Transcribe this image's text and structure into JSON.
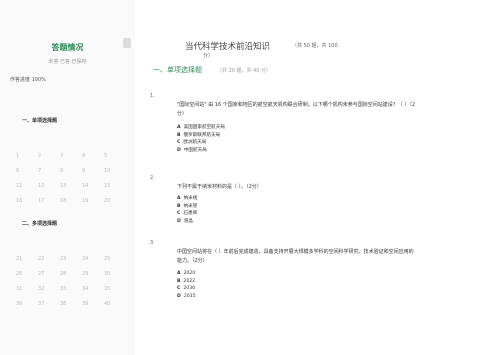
{
  "sidebar": {
    "title": "答题情况",
    "stats": "未答 已答 已保存",
    "progress": "作答进度 100%",
    "sections": [
      {
        "title": "一、单项选择题",
        "numbers": [
          "1",
          "2",
          "3",
          "4",
          "5",
          "6",
          "7",
          "8",
          "9",
          "10",
          "11",
          "12",
          "13",
          "14",
          "15",
          "16",
          "17",
          "18",
          "19",
          "20"
        ]
      },
      {
        "title": "二、多项选择题",
        "numbers": [
          "21",
          "22",
          "23",
          "24",
          "25",
          "26",
          "27",
          "28",
          "29",
          "30",
          "31",
          "32",
          "33",
          "34",
          "35",
          "36",
          "37",
          "38",
          "39",
          "40"
        ]
      }
    ]
  },
  "doc": {
    "title": "当代科学技术前沿知识",
    "meta": "（共 50 题，共 100",
    "meta2": "分）",
    "part_title": "一、单项选择题",
    "part_meta": "（共 20 题，共 40 分）"
  },
  "questions": [
    {
      "num": "1.",
      "text": "\"国际空间站\" 由 16 个国家和地区的航空航天机构联合研制，以下哪个机构未参与国际空间站建设？（ ）（2分）",
      "options": [
        {
          "label": "A",
          "text": "美国国家航空航天局",
          "color": "normal"
        },
        {
          "label": "B",
          "text": "俄罗斯联邦航天局",
          "color": "orange"
        },
        {
          "label": "C",
          "text": "欧洲航天局",
          "color": "normal"
        },
        {
          "label": "D",
          "text": "中国航天局",
          "color": "normal"
        }
      ]
    },
    {
      "num": "2.",
      "text": "下列不属于纳米材料的是（ ）。（2分）",
      "options": [
        {
          "label": "A",
          "text": "纳米线",
          "color": "normal"
        },
        {
          "label": "B",
          "text": "纳米管",
          "color": "normal"
        },
        {
          "label": "C",
          "text": "石墨烯",
          "color": "normal"
        },
        {
          "label": "D",
          "text": "液晶",
          "color": "orange"
        }
      ]
    },
    {
      "num": "3.",
      "text": "中国空间站将在（ ）年前后完成建造，具备支持开展大规模多学科的空间科学研究、技术验证和空间应用的能力。（2分）",
      "options": [
        {
          "label": "A",
          "text": "2020",
          "color": "normal"
        },
        {
          "label": "B",
          "text": "2022",
          "color": "orange"
        },
        {
          "label": "C",
          "text": "2030",
          "color": "normal"
        },
        {
          "label": "D",
          "text": "2035",
          "color": "normal"
        }
      ]
    }
  ]
}
